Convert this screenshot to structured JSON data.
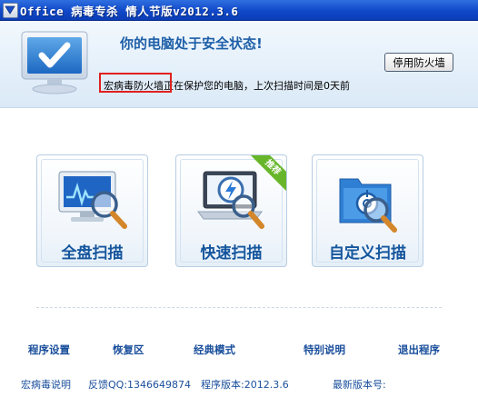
{
  "window": {
    "title": "Office 病毒专杀 情人节版v2012.3.6"
  },
  "status": {
    "headline": "你的电脑处于安全状态!",
    "message": "宏病毒防火墙正在保护您的电脑，上次扫描时间是0天前",
    "disable_button": "停用防火墙"
  },
  "scan_tiles": [
    {
      "label": "全盘扫描",
      "icon": "monitor-scan-icon"
    },
    {
      "label": "快速扫描",
      "icon": "laptop-quick-scan-icon",
      "badge": "推荐"
    },
    {
      "label": "自定义扫描",
      "icon": "folder-target-icon"
    }
  ],
  "bottom_links": [
    "程序设置",
    "恢复区",
    "经典模式",
    "特别说明",
    "退出程序"
  ],
  "info": {
    "macro_virus_desc": "宏病毒说明",
    "feedback_qq": "反馈QQ:1346649874",
    "program_version": "程序版本:2012.3.6",
    "latest_version": "最新版本号:"
  },
  "colors": {
    "titlebar": "#1048c8",
    "accent_text": "#1e5fa8",
    "link": "#1a4f9c",
    "highlight_border": "#e02020",
    "badge": "#67b62a"
  }
}
